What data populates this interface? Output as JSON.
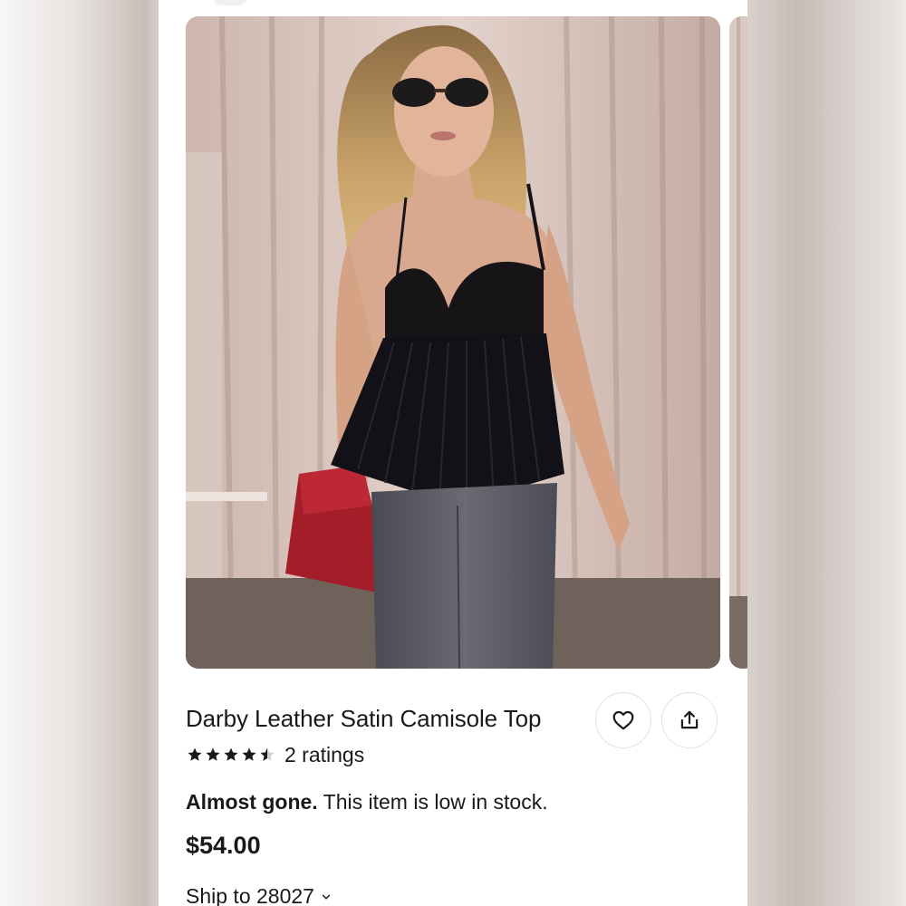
{
  "product": {
    "title": "Darby Leather Satin Camisole Top",
    "rating_value": 4.5,
    "rating_max": 5,
    "rating_count_label": "2 ratings",
    "stock_status_strong": "Almost gone.",
    "stock_status_text": " This item is low in stock.",
    "price": "$54.00"
  },
  "shipping": {
    "label": "Ship to 28027"
  },
  "icons": {
    "favorite": "heart-icon",
    "share": "share-icon",
    "ship_dropdown": "chevron-down-icon",
    "star": "star-icon"
  },
  "colors": {
    "text": "#191919",
    "border": "#e2e2e2",
    "background": "#ffffff"
  }
}
